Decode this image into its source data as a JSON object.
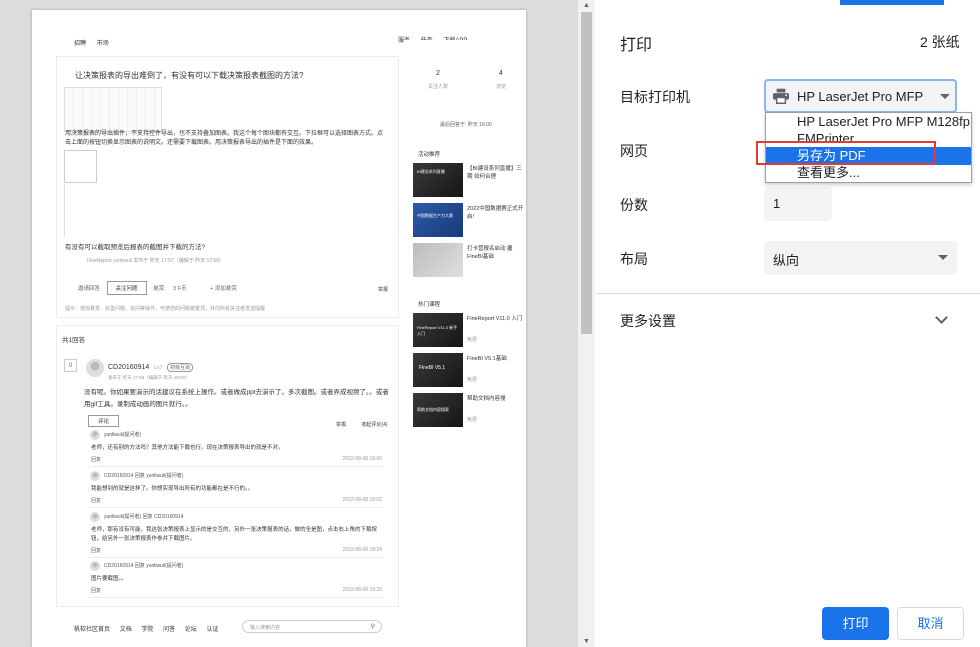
{
  "preview": {
    "nav_left": [
      "招聘",
      "市场"
    ],
    "nav_right": [
      "服务",
      "任务",
      "下载APP"
    ],
    "question_title": "让决策报表的导出难倒了，有没有可以下载决策报表截图的方法?",
    "question_body": "用决策报表的导出插件，不支持控件导出，也不支持叠加图表。我这个每个图块都有交互。下拉框可以选择图表方式。点击上面的按钮切换显示图表的说明文。还需要下载图表。用决策报表导出的插件是下面的效果。",
    "question_sub": "有没有可以截取预览后报表的截图并下载的方法?",
    "question_meta": "FineReport    yunliwuli    发布于 昨天 17:57（编辑于 昨天 17:58）",
    "invite_label": "邀请回答",
    "follow_label": "关注问题",
    "reward_label": "悬赏:",
    "reward_value": "3 F币",
    "add_reward": "+ 添加悬赏",
    "report_label": "举报",
    "tip": "提示：增加悬赏、完善问题、追问等操作，可使您的问题被置顶，并向所有关注者发送提醒",
    "answers_head": "共1回答",
    "vote": "0",
    "answer_user": "CD20160914",
    "answer_level": "Lv7",
    "answer_badge": "初级互助",
    "answer_time": "发布于 昨天 17:58（编辑于 昨天 18:00）",
    "answer_text": "没有呢。你如果要演示的话建议在系统上操作。或者做成ppt去演示了。多次截图。或者弄成视频了。。或者用gif工具。录制成动画的图片就行。。",
    "comment_label": "评论",
    "answer_report": "举报",
    "adopt_label": "收起评论(4)",
    "replies": [
      {
        "user": "yunliwuli(提问者)",
        "text": "老师，还有别的方法吗？其他方法能下载也行。现在决策报表导出的就是不对。",
        "action": "回复",
        "date": "2022-08-08 18:00"
      },
      {
        "user": "CD20160914 回复 yunliwuli(提问者)",
        "text": "我能想到的就是这样了。你想实现导出所有的功能都在是不行的。。",
        "action": "回复",
        "date": "2022-08-08 18:02"
      },
      {
        "user": "yunliwuli(提问者) 回复 CD20160914",
        "text": "老师，那有没有可能，我这张决策报表上显示的是交互的，另外一张决策报表的话，做的全是图，点击右上角的下载按钮，给另外一张决策报表作参并下载图片。",
        "action": "回复",
        "date": "2022-08-08 18:24"
      },
      {
        "user": "CD20160914 回复 yunliwuli(提问者)",
        "text": "图片要截图。。",
        "action": "回复",
        "date": "2022-08-08 19:20"
      }
    ],
    "footer_links": [
      "帆软社区首页",
      "文档",
      "学院",
      "问答",
      "论坛",
      "认证"
    ],
    "footer_search_placeholder": "输入搜索内容",
    "stats": [
      {
        "value": "2",
        "label": "关注人数"
      },
      {
        "value": "4",
        "label": "浏览"
      }
    ],
    "last_answer": "最后回答于: 昨天 18:00",
    "side_recommend_head": "活动推荐",
    "side_course_head": "热门课程",
    "recommend": [
      {
        "title": "【BI建设系列直播】三期 如何合理",
        "img_text": "BI建设系列直播"
      },
      {
        "title": "2022中国数据赛正式开启!",
        "img_text": "中国数据生产力大赛"
      },
      {
        "title": "打卡营报名启动 握FineBI基础",
        "img_text": ""
      }
    ],
    "courses": [
      {
        "title": "FineReport V11.0 入门",
        "free": "免费",
        "img_text": "FineReport V11.0 新手入门"
      },
      {
        "title": "FineBI V5.1基础",
        "free": "免费",
        "img_text": "FineBI V5.1"
      },
      {
        "title": "帮助文档内容搜",
        "free": "免费",
        "img_text": "帮助文档内容搜索"
      }
    ]
  },
  "print_panel": {
    "title": "打印",
    "sheet_count": "2 张纸",
    "destination_label": "目标打印机",
    "destination_value": "HP LaserJet Pro MFP",
    "dropdown_options": [
      "HP LaserJet Pro MFP M128fp",
      "FMPrinter",
      "另存为 PDF",
      "查看更多..."
    ],
    "selected_option_index": 2,
    "pages_label": "网页",
    "copies_label": "份数",
    "copies_value": "1",
    "layout_label": "布局",
    "layout_value": "纵向",
    "more_settings": "更多设置",
    "print_button": "打印",
    "cancel_button": "取消"
  },
  "colors": {
    "accent": "#1a73e8",
    "highlight_box": "#e53935",
    "panel_field_bg": "#f1f3f4",
    "preview_bg": "#dcdcdc"
  }
}
